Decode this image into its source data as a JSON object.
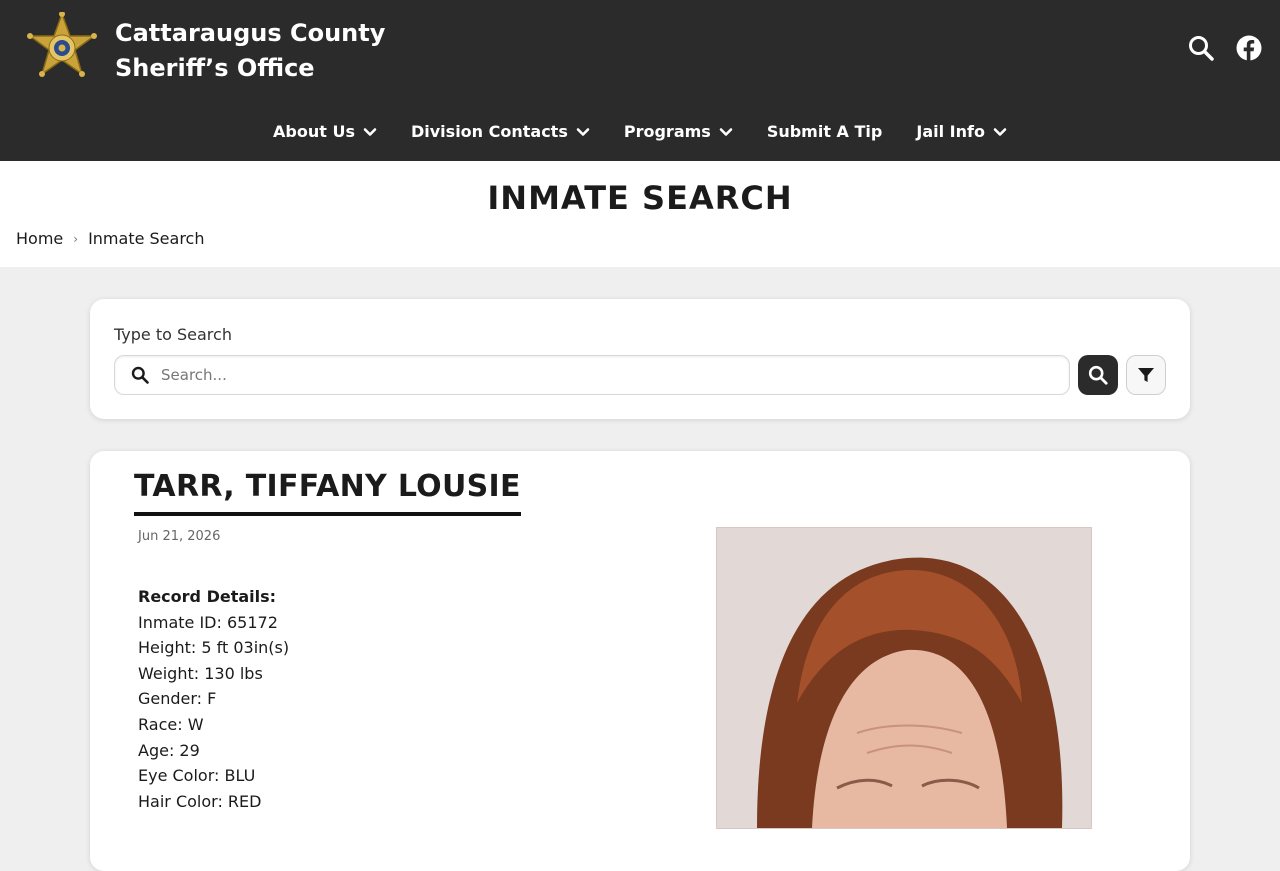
{
  "header": {
    "title_line1": "Cattaraugus County",
    "title_line2": "Sheriff’s Office",
    "icons": [
      "search-icon",
      "facebook-icon"
    ]
  },
  "nav": {
    "items": [
      {
        "label": "About Us",
        "has_dropdown": true
      },
      {
        "label": "Division Contacts",
        "has_dropdown": true
      },
      {
        "label": "Programs",
        "has_dropdown": true
      },
      {
        "label": "Submit A Tip",
        "has_dropdown": false
      },
      {
        "label": "Jail Info",
        "has_dropdown": true
      }
    ]
  },
  "page": {
    "title": "INMATE SEARCH",
    "breadcrumb": [
      "Home",
      "Inmate Search"
    ]
  },
  "search": {
    "label": "Type to Search",
    "placeholder": "Search...",
    "value": ""
  },
  "record": {
    "name": "TARR, TIFFANY LOUSIE",
    "date": "Jun 21, 2026",
    "details_heading": "Record Details:",
    "details": [
      "Inmate ID: 65172",
      "Height: 5 ft 03in(s)",
      "Weight: 130 lbs",
      "Gender: F",
      "Race: W",
      "Age: 29",
      "Eye Color: BLU",
      "Hair Color: RED"
    ]
  },
  "colors": {
    "header_bg": "#2b2b2b",
    "page_bg": "#efefef",
    "card_bg": "#ffffff",
    "accent": "#111111"
  }
}
